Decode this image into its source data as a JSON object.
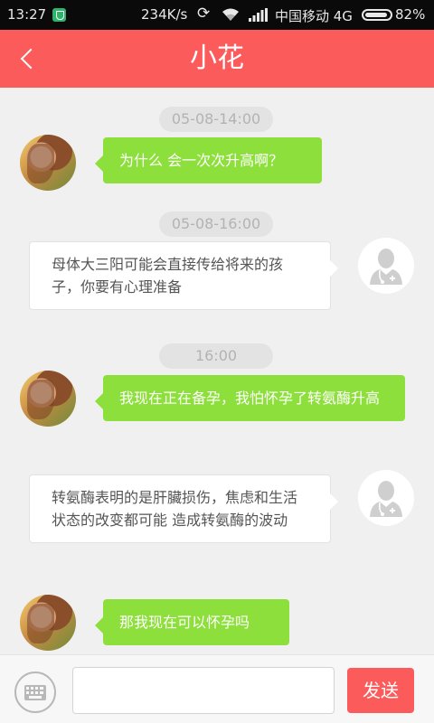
{
  "status_bar": {
    "time": "13:27",
    "speed": "234K/s",
    "carrier": "中国移动 4G",
    "battery": "82%",
    "icons": [
      "security-shield-icon",
      "sync-icon",
      "wifi-icon",
      "signal-icon",
      "battery-icon"
    ]
  },
  "header": {
    "title": "小花",
    "back_icon": "chevron-left-icon",
    "background": "#fb5b5b"
  },
  "messages": [
    {
      "type": "timestamp",
      "text": "05-08-14:00"
    },
    {
      "type": "sent",
      "text": "为什么 会一次次升高啊？"
    },
    {
      "type": "timestamp",
      "text": "05-08-16:00"
    },
    {
      "type": "received",
      "text": "母体大三阳可能会直接传给将来的孩子，你要有心理准备"
    },
    {
      "type": "timestamp",
      "text": "16:00"
    },
    {
      "type": "sent",
      "text": "我现在正在备孕，我怕怀孕了转氨酶升高"
    },
    {
      "type": "received",
      "text": "转氨酶表明的是肝臟损伤，焦虑和生活状态的改变都可能 造成转氨酶的波动"
    },
    {
      "type": "sent",
      "text": "那我现在可以怀孕吗"
    }
  ],
  "input_bar": {
    "keyboard_icon": "keyboard-icon",
    "input_value": "",
    "send_label": "发送"
  },
  "colors": {
    "accent": "#fb5b5b",
    "sent_bubble": "#8ddf3b",
    "received_bubble": "#ffffff"
  }
}
